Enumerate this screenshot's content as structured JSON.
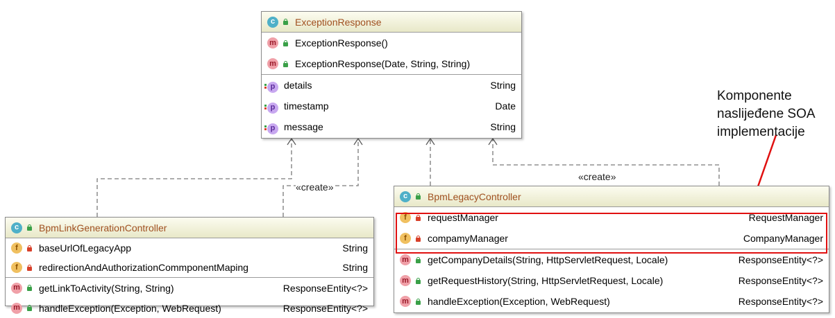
{
  "exception_response": {
    "badge": "c",
    "title": "ExceptionResponse",
    "constructors": [
      {
        "kind": "m",
        "name": "ExceptionResponse()"
      },
      {
        "kind": "m",
        "name": "ExceptionResponse(Date, String, String)"
      }
    ],
    "properties": [
      {
        "kind": "p",
        "name": "details",
        "type": "String"
      },
      {
        "kind": "p",
        "name": "timestamp",
        "type": "Date"
      },
      {
        "kind": "p",
        "name": "message",
        "type": "String"
      }
    ]
  },
  "link_controller": {
    "badge": "c",
    "title": "BpmLinkGenerationController",
    "fields": [
      {
        "kind": "f",
        "name": "baseUrlOfLegacyApp",
        "type": "String"
      },
      {
        "kind": "f",
        "name": "redirectionAndAuthorizationCommponentMaping",
        "type": "String"
      }
    ],
    "methods": [
      {
        "kind": "m",
        "name": "getLinkToActivity(String, String)",
        "type": "ResponseEntity<?>"
      },
      {
        "kind": "m",
        "name": "handleException(Exception, WebRequest)",
        "type": "ResponseEntity<?>"
      }
    ]
  },
  "legacy_controller": {
    "badge": "c",
    "title": "BpmLegacyController",
    "fields": [
      {
        "kind": "f",
        "name": "requestManager",
        "type": "RequestManager"
      },
      {
        "kind": "f",
        "name": "compamyManager",
        "type": "CompanyManager"
      }
    ],
    "methods": [
      {
        "kind": "m",
        "name": "getCompanyDetails(String, HttpServletRequest, Locale)",
        "type": "ResponseEntity<?>"
      },
      {
        "kind": "m",
        "name": "getRequestHistory(String, HttpServletRequest, Locale)",
        "type": "ResponseEntity<?>"
      },
      {
        "kind": "m",
        "name": "handleException(Exception, WebRequest)",
        "type": "ResponseEntity<?>"
      }
    ]
  },
  "edges": {
    "create_label_left": "«create»",
    "create_label_right": "«create»"
  },
  "annotation": {
    "lines": [
      "Komponente",
      "naslijeđene SOA",
      "implementacije"
    ],
    "color": "#e01010"
  },
  "colors": {
    "header_title": "#a05020",
    "header_bg": "#e8e8c8",
    "highlight": "#e01010"
  }
}
